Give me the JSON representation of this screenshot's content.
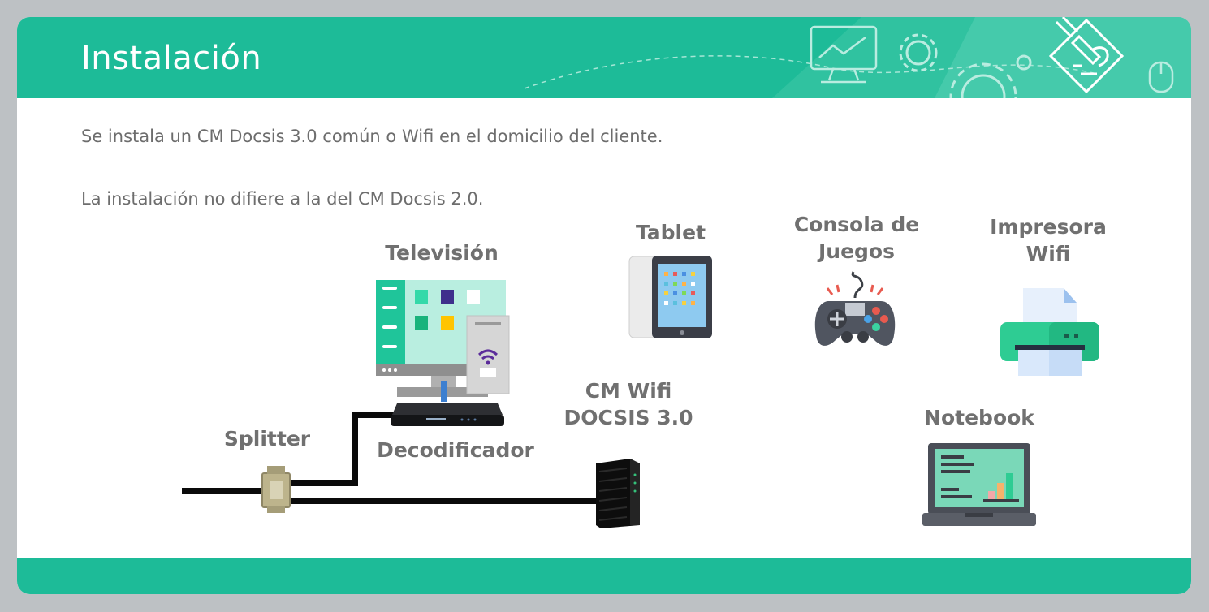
{
  "header": {
    "title": "Instalación",
    "accent_color": "#1dbb98",
    "icons": [
      "monitor-icon",
      "gear-icon",
      "mouse-icon",
      "pencil-puzzle-icon"
    ]
  },
  "body": {
    "paragraph_1": "Se instala un CM Docsis 3.0 común o Wifi en el domicilio del cliente.",
    "paragraph_2": "La instalación no difiere a la del CM Docsis 2.0."
  },
  "diagram": {
    "labels": {
      "television": "Televisión",
      "tablet": "Tablet",
      "console_line1": "Consola de",
      "console_line2": "Juegos",
      "printer_line1": "Impresora",
      "printer_line2": "Wifi",
      "cm_wifi_line1": "CM Wifi",
      "cm_wifi_line2": "DOCSIS 3.0",
      "notebook": "Notebook",
      "splitter": "Splitter",
      "decoder": "Decodificador"
    }
  }
}
